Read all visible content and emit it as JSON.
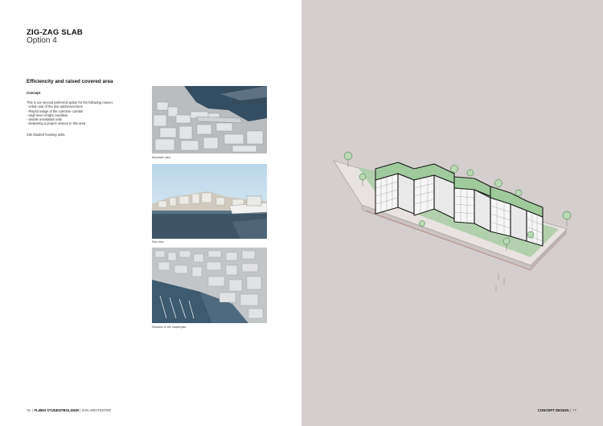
{
  "header": {
    "title": "ZIG-ZAG SLAB",
    "subtitle": "Option 4"
  },
  "section": {
    "heading": "Efficiencity and raised covered area",
    "concept_label": "Concept",
    "lines": [
      "This is our second preferred option for the following reason:",
      "- Urban use of the plot addressed best",
      "- Playful usage of the colective corridor",
      "- High level of light condition",
      "- double orientated units",
      "- Delivering a project unseen in this area"
    ],
    "units": "236 Student housing units."
  },
  "images": [
    {
      "name": "mountain-view-image",
      "caption": "Mountain view"
    },
    {
      "name": "sea-view-image",
      "caption": "Sea view"
    },
    {
      "name": "masterplan-image",
      "caption": "Situtaion in the masterplan"
    }
  ],
  "footer": {
    "page_left": "76",
    "project": "FLØEN STUDENTBOLIGER",
    "firm": "ZAN ARKITEKTER",
    "section_right": "CONCEPT DESIGN",
    "page_right": "77"
  },
  "colors": {
    "right_background": "#d4cfce",
    "green_roof": "#9fca9c",
    "sea": "#3c5a70",
    "building": "#f5f5f5"
  }
}
